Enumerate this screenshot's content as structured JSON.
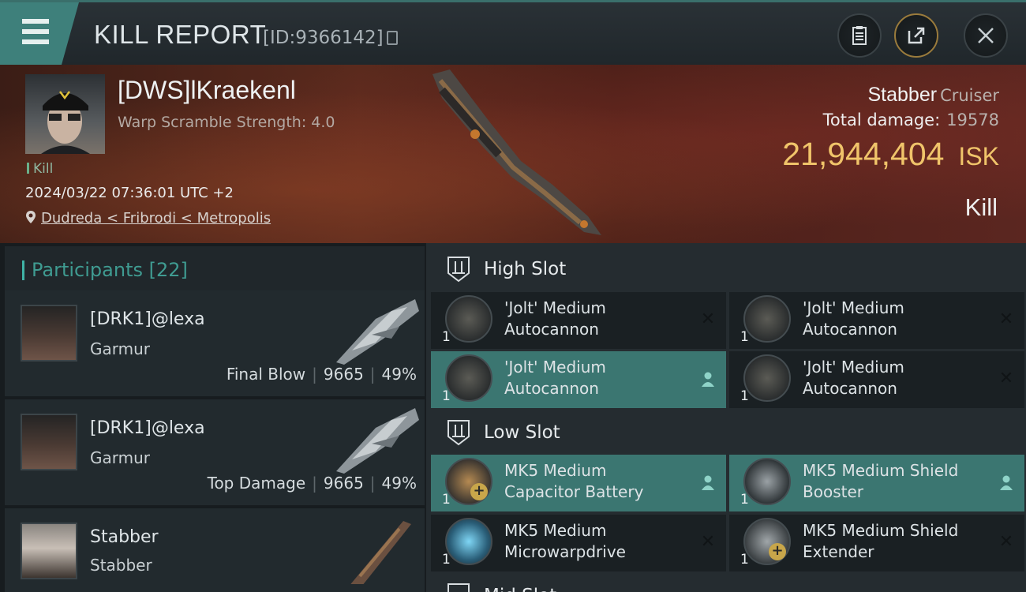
{
  "header": {
    "title": "KILL REPORT",
    "report_id": "[ID:9366142]",
    "icons": [
      "menu-icon",
      "clipboard-icon",
      "share-icon",
      "close-icon"
    ]
  },
  "victim": {
    "name": "[DWS]lKraekenl",
    "warp_scramble": "Warp Scramble Strength: 4.0",
    "kill_tag": "Kill",
    "timestamp": "2024/03/22 07:36:01 UTC +2",
    "location": "Dudreda < Fribrodi < Metropolis",
    "ship": "Stabber",
    "ship_class": "Cruiser",
    "total_damage_label": "Total damage:",
    "total_damage": "19578",
    "isk_value": "21,944,404",
    "isk_unit": "ISK",
    "result": "Kill"
  },
  "participants": {
    "title": "Participants",
    "count": "[22]",
    "items": [
      {
        "name": "[DRK1]@lexa",
        "ship": "Garmur",
        "role": "Final Blow",
        "damage": "9665",
        "percent": "49%"
      },
      {
        "name": "[DRK1]@lexa",
        "ship": "Garmur",
        "role": "Top Damage",
        "damage": "9665",
        "percent": "49%"
      },
      {
        "name": "Stabber",
        "ship": "Stabber"
      }
    ]
  },
  "slots": {
    "high": {
      "title": "High Slot",
      "modules": [
        {
          "line1": "'Jolt' Medium",
          "line2": "Autocannon",
          "qty": "1",
          "state": "destroyed"
        },
        {
          "line1": "'Jolt' Medium",
          "line2": "Autocannon",
          "qty": "1",
          "state": "destroyed"
        },
        {
          "line1": "'Jolt' Medium",
          "line2": "Autocannon",
          "qty": "1",
          "state": "dropped"
        },
        {
          "line1": "'Jolt' Medium",
          "line2": "Autocannon",
          "qty": "1",
          "state": "destroyed"
        }
      ]
    },
    "low": {
      "title": "Low Slot",
      "modules": [
        {
          "line1": "MK5 Medium",
          "line2": "Capacitor Battery",
          "qty": "1",
          "state": "dropped"
        },
        {
          "line1": "MK5 Medium Shield",
          "line2": "Booster",
          "qty": "1",
          "state": "dropped"
        },
        {
          "line1": "MK5 Medium",
          "line2": "Microwarpdrive",
          "qty": "1",
          "state": "destroyed"
        },
        {
          "line1": "MK5 Medium Shield",
          "line2": "Extender",
          "qty": "1",
          "state": "destroyed"
        }
      ]
    },
    "mid": {
      "title": "Mid Slot"
    }
  },
  "colors": {
    "accent_teal": "#3e807b",
    "isk_gold": "#f0c46a",
    "fitted_module": "#3b7671"
  }
}
